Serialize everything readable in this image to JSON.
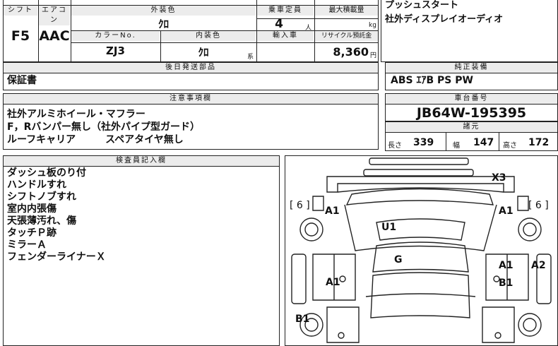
{
  "top_table": {
    "shift_label": "シフト",
    "aircon_label": "エアコン",
    "shift_value": "F5",
    "aircon_value": "AAC",
    "ext_color_label": "外装色",
    "ext_color_value": "ｸﾛ",
    "capacity_label": "乗車定員",
    "capacity_value": "4",
    "capacity_unit": "人",
    "max_load_label": "最大積載量",
    "max_load_unit": "kg",
    "color_no_label": "カラーNo.",
    "color_no_value": "ZJ3",
    "int_color_label": "内装色",
    "int_color_value": "ｸﾛ",
    "int_color_suffix": "系",
    "import_label": "輸入車",
    "recycle_label": "リサイクル預託金",
    "recycle_value": "8,360",
    "recycle_unit": "円"
  },
  "equipment_notes": [
    "プッシュスタート",
    "社外ディスプレイオーディオ"
  ],
  "later_parts": {
    "header": "後日発送部品",
    "items": [
      "保証書"
    ]
  },
  "genuine_equipment": {
    "header": "純正装備",
    "value": "ABS ｴｱB PS PW"
  },
  "caution": {
    "header": "注意事項欄",
    "lines": [
      "社外アルミホイール・マフラー",
      "F，Rバンパー無し（社外パイプ型ガード）",
      "ルーフキャリア　　　スペアタイヤ無し"
    ]
  },
  "chassis": {
    "header": "車台番号",
    "value": "JB64W-195395"
  },
  "specs": {
    "header": "諸元",
    "length_label": "長さ",
    "length_value": "339",
    "width_label": "幅",
    "width_value": "147",
    "height_label": "高さ",
    "height_value": "172"
  },
  "inspector": {
    "header": "検査員記入欄",
    "lines": [
      "ダッシュ板のり付",
      "ハンドルすれ",
      "シフトノブすれ",
      "室内内張傷",
      "天張薄汚れ、傷",
      "タッチＰ跡",
      "ミラーＡ",
      "フェンダーライナーＸ"
    ]
  },
  "diagram_marks": {
    "x3": "X3",
    "a1_fl": "A1",
    "a1_fr": "A1",
    "six_left": "[ 6 ]",
    "six_right": "[ 6 ]",
    "u1": "U1",
    "g": "G",
    "a1_mid_r": "A1",
    "a2": "A2",
    "a1_mid_l": "A1",
    "b1_r": "B1",
    "b1_l": "B1"
  }
}
